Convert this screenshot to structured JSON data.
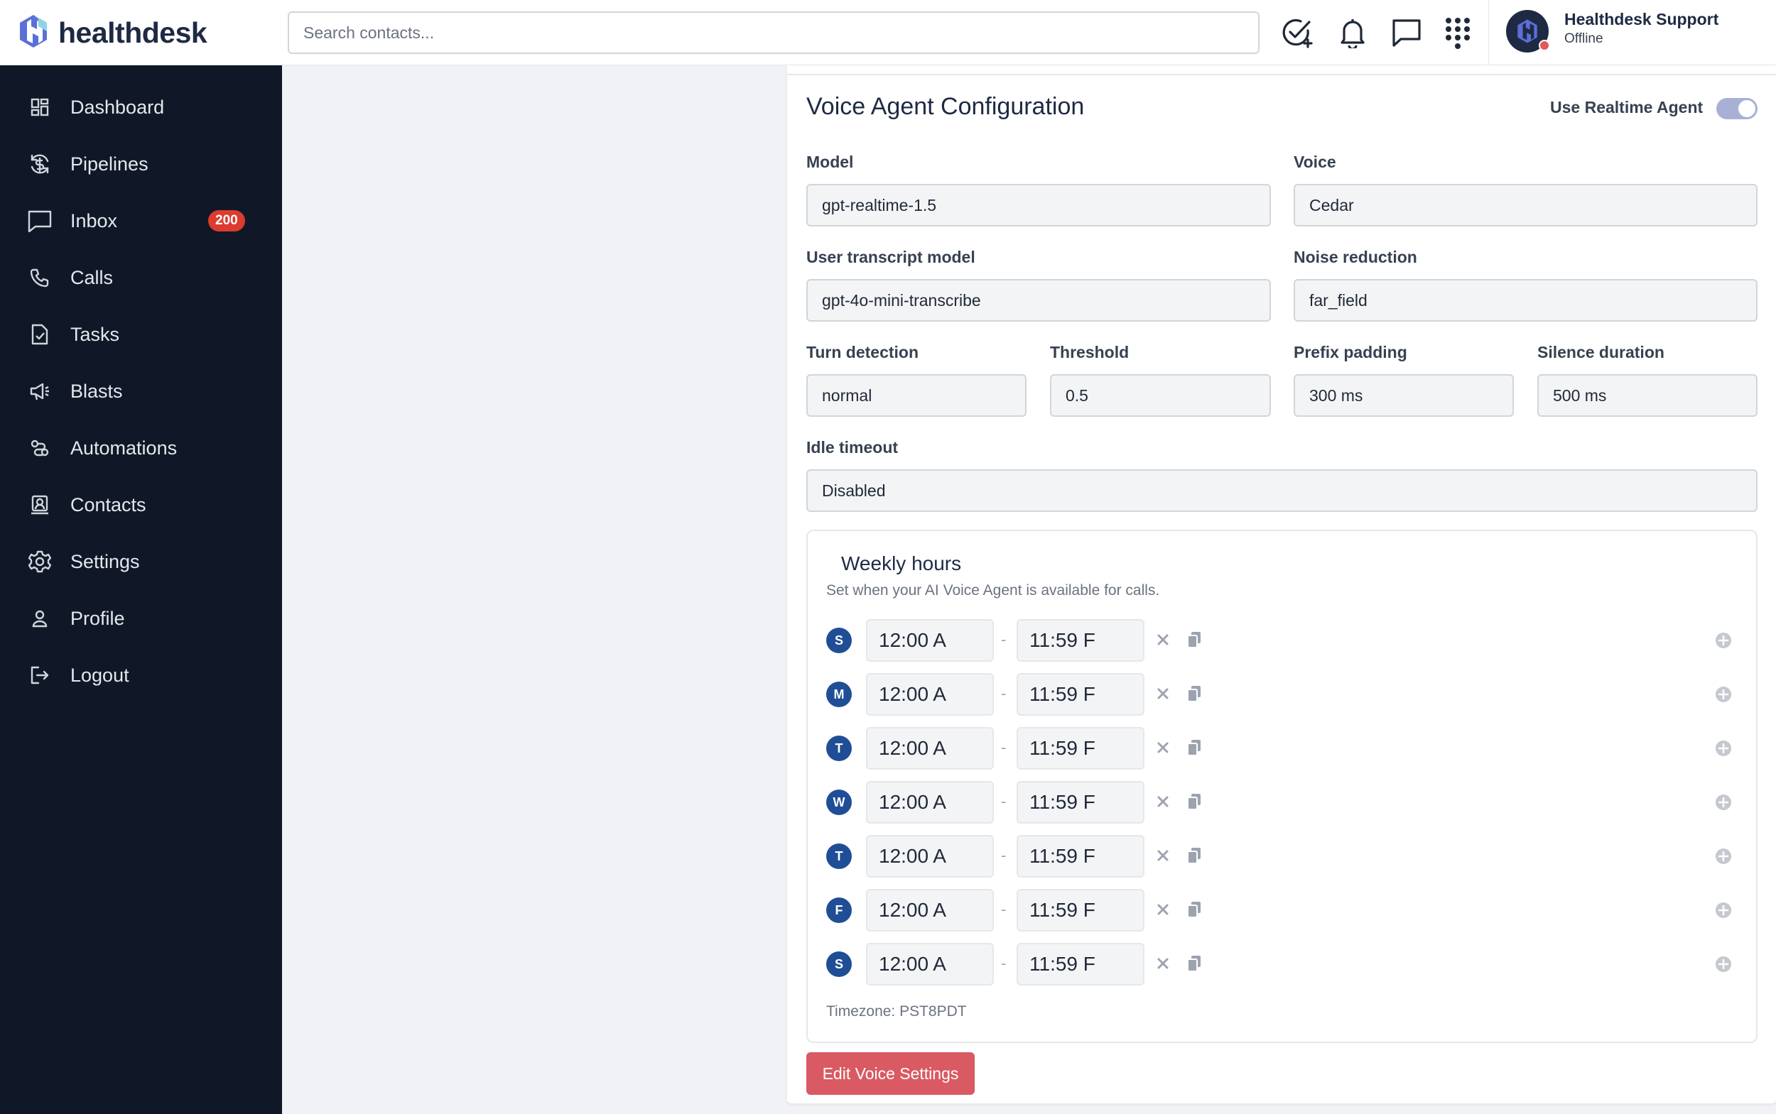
{
  "app": {
    "brand": "healthdesk"
  },
  "search": {
    "placeholder": "Search contacts..."
  },
  "topbar_icons": [
    "task-add-icon",
    "bell-icon",
    "chat-icon",
    "apps-grid-icon"
  ],
  "user": {
    "name": "Healthdesk Support",
    "status": "Offline"
  },
  "sidebar": {
    "items": [
      {
        "label": "Dashboard",
        "icon": "dashboard-icon"
      },
      {
        "label": "Pipelines",
        "icon": "pipelines-icon"
      },
      {
        "label": "Inbox",
        "icon": "inbox-icon",
        "badge": "200"
      },
      {
        "label": "Calls",
        "icon": "phone-icon"
      },
      {
        "label": "Tasks",
        "icon": "tasks-icon"
      },
      {
        "label": "Blasts",
        "icon": "megaphone-icon"
      },
      {
        "label": "Automations",
        "icon": "automations-icon"
      },
      {
        "label": "Contacts",
        "icon": "contacts-icon"
      },
      {
        "label": "Settings",
        "icon": "gear-icon"
      },
      {
        "label": "Profile",
        "icon": "user-icon"
      },
      {
        "label": "Logout",
        "icon": "logout-icon"
      }
    ]
  },
  "config": {
    "title": "Voice Agent Configuration",
    "realtime_label": "Use Realtime Agent",
    "realtime_enabled": true,
    "model": {
      "label": "Model",
      "value": "gpt-realtime-1.5"
    },
    "voice": {
      "label": "Voice",
      "value": "Cedar"
    },
    "transcript_model": {
      "label": "User transcript model",
      "value": "gpt-4o-mini-transcribe"
    },
    "noise_reduction": {
      "label": "Noise reduction",
      "value": "far_field"
    },
    "turn_detection": {
      "label": "Turn detection",
      "value": "normal"
    },
    "threshold": {
      "label": "Threshold",
      "value": "0.5"
    },
    "prefix_padding": {
      "label": "Prefix padding",
      "value": "300 ms"
    },
    "silence_duration": {
      "label": "Silence duration",
      "value": "500 ms"
    },
    "idle_timeout": {
      "label": "Idle timeout",
      "value": "Disabled"
    }
  },
  "weekly_hours": {
    "title": "Weekly hours",
    "subtitle": "Set when your AI Voice Agent is available for calls.",
    "days": [
      {
        "letter": "S",
        "start": "12:00 A",
        "end": "11:59 F"
      },
      {
        "letter": "M",
        "start": "12:00 A",
        "end": "11:59 F"
      },
      {
        "letter": "T",
        "start": "12:00 A",
        "end": "11:59 F"
      },
      {
        "letter": "W",
        "start": "12:00 A",
        "end": "11:59 F"
      },
      {
        "letter": "T",
        "start": "12:00 A",
        "end": "11:59 F"
      },
      {
        "letter": "F",
        "start": "12:00 A",
        "end": "11:59 F"
      },
      {
        "letter": "S",
        "start": "12:00 A",
        "end": "11:59 F"
      }
    ],
    "separator": "-",
    "timezone": "Timezone: PST8PDT"
  },
  "actions": {
    "edit_label": "Edit Voice Settings"
  },
  "colors": {
    "sidebar_bg": "#101828",
    "primary": "#1f4e96",
    "danger_button": "#d95a62",
    "badge": "#dc3b2f"
  }
}
